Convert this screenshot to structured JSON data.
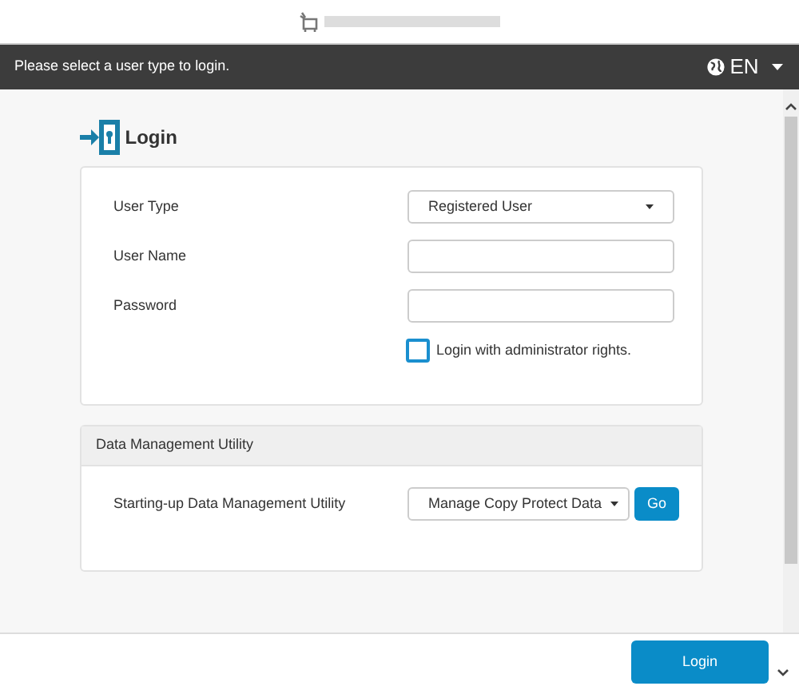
{
  "top_bar": {
    "message": "Please select a user type to login.",
    "language": "EN"
  },
  "login": {
    "title": "Login",
    "fields": [
      {
        "kind": "select",
        "label": "User Type",
        "value": "Registered User"
      },
      {
        "kind": "text",
        "label": "User Name"
      },
      {
        "kind": "password",
        "label": "Password"
      }
    ],
    "admin_checkbox": {
      "label": "Login with administrator rights.",
      "checked": false
    }
  },
  "utility": {
    "title": "Data Management Utility",
    "label": "Starting-up Data Management Utility",
    "value": "Manage Copy Protect Data",
    "go_button": "Go"
  },
  "footer": {
    "login_button": "Login"
  }
}
